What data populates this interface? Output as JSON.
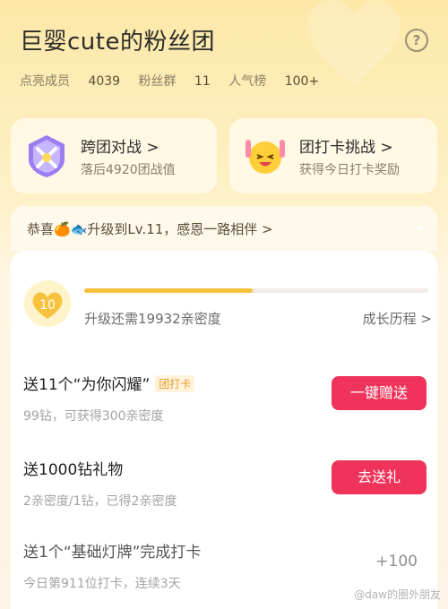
{
  "header": {
    "title": "巨婴cute的粉丝团",
    "help_icon": "question-circle-icon"
  },
  "stats": {
    "lit_label": "点亮成员",
    "lit_value": "4039",
    "group_label": "粉丝群",
    "group_value": "11",
    "rank_label": "人气榜",
    "rank_value": "100+"
  },
  "cards": [
    {
      "title": "跨团对战 >",
      "subtitle": "落后4920团战值",
      "icon": "battle-shield-icon"
    },
    {
      "title": "团打卡挑战 >",
      "subtitle": "获得今日打卡奖励",
      "icon": "cheering-emoji-icon"
    }
  ],
  "congrats": {
    "text": "恭喜🍊🐟升级到Lv.11，感恩一路相伴 >"
  },
  "level": {
    "badge_number": "10",
    "progress": 0.49,
    "upgrade_text": "升级还需19932亲密度",
    "growth_link": "成长历程 >"
  },
  "tasks": [
    {
      "title": "送11个“为你闪耀”",
      "tag": "团打卡",
      "subtitle": "99钻，可获得300亲密度",
      "button": "一键赠送"
    },
    {
      "title": "送1000钻礼物",
      "subtitle": "2亲密度/1钻，已得2亲密度",
      "button": "去送礼"
    },
    {
      "title": "送1个“基础灯牌”完成打卡",
      "subtitle": "今日第911位打卡，连续3天",
      "reward": "+100"
    }
  ],
  "watermark": "@daw的圈外朋友",
  "colors": {
    "accent": "#f0335a",
    "progress": "#f5c13d"
  }
}
